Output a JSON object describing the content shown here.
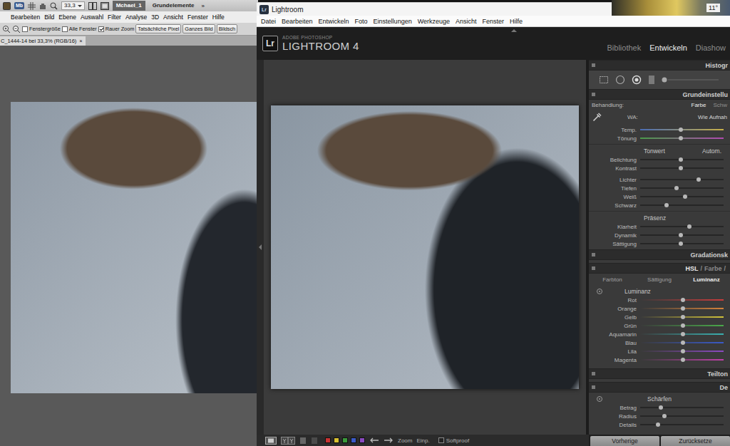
{
  "desktop": {
    "gadget_text": "11°"
  },
  "photoshop": {
    "appbar": {
      "launcher": "Mb",
      "zoom": "33,3",
      "workspaces": [
        {
          "label": "Mchael_1",
          "selected": true
        },
        {
          "label": "Grundelemente",
          "selected": false
        }
      ],
      "more": "»"
    },
    "menu": [
      "Bearbeiten",
      "Bild",
      "Ebene",
      "Auswahl",
      "Filter",
      "Analyse",
      "3D",
      "Ansicht",
      "Fenster",
      "Hilfe"
    ],
    "options": [
      {
        "kind": "checkbox",
        "label": "Fenstergröße",
        "checked": false
      },
      {
        "kind": "checkbox",
        "label": "Alle Fenster",
        "checked": false
      },
      {
        "kind": "checkbox",
        "label": "Rauer Zoom",
        "checked": true
      },
      {
        "kind": "button",
        "label": "Tatsächliche Pixel"
      },
      {
        "kind": "button",
        "label": "Ganzes Bild"
      },
      {
        "kind": "button",
        "label": "Bildsch"
      }
    ],
    "document_tab": {
      "title": "C_1444-14 bei 33,3% (RGB/16)",
      "close": "×"
    }
  },
  "lightroom": {
    "window": {
      "icon": "Lr",
      "title": "Lightroom"
    },
    "menu": [
      "Datei",
      "Bearbeiten",
      "Entwickeln",
      "Foto",
      "Einstellungen",
      "Werkzeuge",
      "Ansicht",
      "Fenster",
      "Hilfe"
    ],
    "identity": {
      "mark": "Lr",
      "vendor": "ADOBE PHOTOSHOP",
      "product": "LIGHTROOM 4"
    },
    "modules": [
      {
        "label": "Bibliothek",
        "selected": false
      },
      {
        "label": "Entwickeln",
        "selected": true
      },
      {
        "label": "Diashow",
        "selected": false
      }
    ],
    "panel": {
      "histogram": {
        "title": "Histogr"
      },
      "basic": {
        "title": "Grundeinstellu",
        "treatment": {
          "label": "Behandlung:",
          "options": [
            {
              "label": "Farbe",
              "selected": true
            },
            {
              "label": "Schw",
              "selected": false
            }
          ]
        },
        "white_balance": {
          "label": "WA:",
          "value": "Wie Aufnah"
        },
        "groups": [
          {
            "sliders": [
              {
                "label": "Temp.",
                "level": 0.49,
                "colors": [
                  "#4a6cb4",
                  "#c8b048"
                ]
              },
              {
                "label": "Tönung",
                "level": 0.49,
                "colors": [
                  "#4a9a4a",
                  "#b04ab0"
                ]
              }
            ]
          },
          {
            "title": "Tonwert",
            "action": "Autom.",
            "sliders": [
              {
                "label": "Belichtung",
                "level": 0.49
              },
              {
                "label": "Kontrast",
                "level": 0.49
              }
            ]
          },
          {
            "sliders": [
              {
                "label": "Lichter",
                "level": 0.7
              },
              {
                "label": "Tiefen",
                "level": 0.44
              },
              {
                "label": "Weiß",
                "level": 0.54
              },
              {
                "label": "Schwarz",
                "level": 0.32
              }
            ]
          },
          {
            "title": "Präsenz",
            "sliders": [
              {
                "label": "Klarheit",
                "level": 0.59
              },
              {
                "label": "Dynamik",
                "level": 0.49
              },
              {
                "label": "Sättigung",
                "level": 0.49
              }
            ]
          }
        ]
      },
      "tone_curve": {
        "title": "Gradationsk"
      },
      "hsl": {
        "modes": [
          {
            "label": "HSL",
            "selected": true
          },
          {
            "label": "Farbe",
            "selected": false
          }
        ],
        "separator": "/",
        "tabs": [
          {
            "label": "Farbton",
            "selected": false
          },
          {
            "label": "Sättigung",
            "selected": false
          },
          {
            "label": "Luminanz",
            "selected": true
          }
        ],
        "group": "Luminanz",
        "sliders": [
          {
            "label": "Rot",
            "level": 0.51,
            "color": "#c83c3c"
          },
          {
            "label": "Orange",
            "level": 0.51,
            "color": "#d4823a"
          },
          {
            "label": "Gelb",
            "level": 0.51,
            "color": "#d2c23a"
          },
          {
            "label": "Grün",
            "level": 0.51,
            "color": "#4aa84a"
          },
          {
            "label": "Aquamarin",
            "level": 0.51,
            "color": "#3ab0b0"
          },
          {
            "label": "Blau",
            "level": 0.51,
            "color": "#3a5ac8"
          },
          {
            "label": "Lila",
            "level": 0.51,
            "color": "#8a4ac0"
          },
          {
            "label": "Magenta",
            "level": 0.51,
            "color": "#c040a8"
          }
        ]
      },
      "split_toning": {
        "title": "Teilton"
      },
      "detail": {
        "title": "De",
        "group": "Schärfen",
        "sliders": [
          {
            "label": "Betrag",
            "level": 0.25
          },
          {
            "label": "Radius",
            "level": 0.29
          },
          {
            "label": "Details",
            "level": 0.21
          }
        ]
      },
      "buttons": [
        "Vorherige",
        "Zurücksetze"
      ]
    },
    "toolbar": {
      "labels": [
        {
          "color": "#c83232"
        },
        {
          "color": "#d8c030"
        },
        {
          "color": "#3a9a3a"
        },
        {
          "color": "#3a5ac8"
        },
        {
          "color": "#8a4ac0"
        }
      ],
      "zoom": "Zoom",
      "fit": "Einp.",
      "softproof": {
        "label": "Softproof",
        "checked": false
      }
    }
  }
}
